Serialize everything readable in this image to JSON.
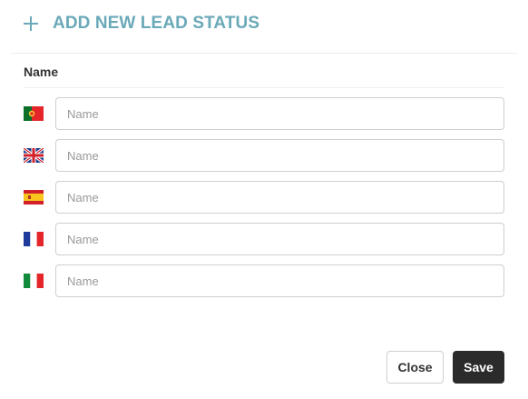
{
  "header": {
    "title": "ADD NEW LEAD STATUS",
    "icon": "plus-icon",
    "accent_color": "#6aa9b8"
  },
  "form": {
    "section_label": "Name",
    "rows": [
      {
        "language": "portuguese",
        "flag_icon": "portugal-flag-icon",
        "value": "",
        "placeholder": "Name"
      },
      {
        "language": "english",
        "flag_icon": "uk-flag-icon",
        "value": "",
        "placeholder": "Name"
      },
      {
        "language": "spanish",
        "flag_icon": "spain-flag-icon",
        "value": "",
        "placeholder": "Name"
      },
      {
        "language": "french",
        "flag_icon": "france-flag-icon",
        "value": "",
        "placeholder": "Name"
      },
      {
        "language": "italian",
        "flag_icon": "italy-flag-icon",
        "value": "",
        "placeholder": "Name"
      }
    ]
  },
  "footer": {
    "close_label": "Close",
    "save_label": "Save",
    "save_color": "#2b2b2b"
  }
}
